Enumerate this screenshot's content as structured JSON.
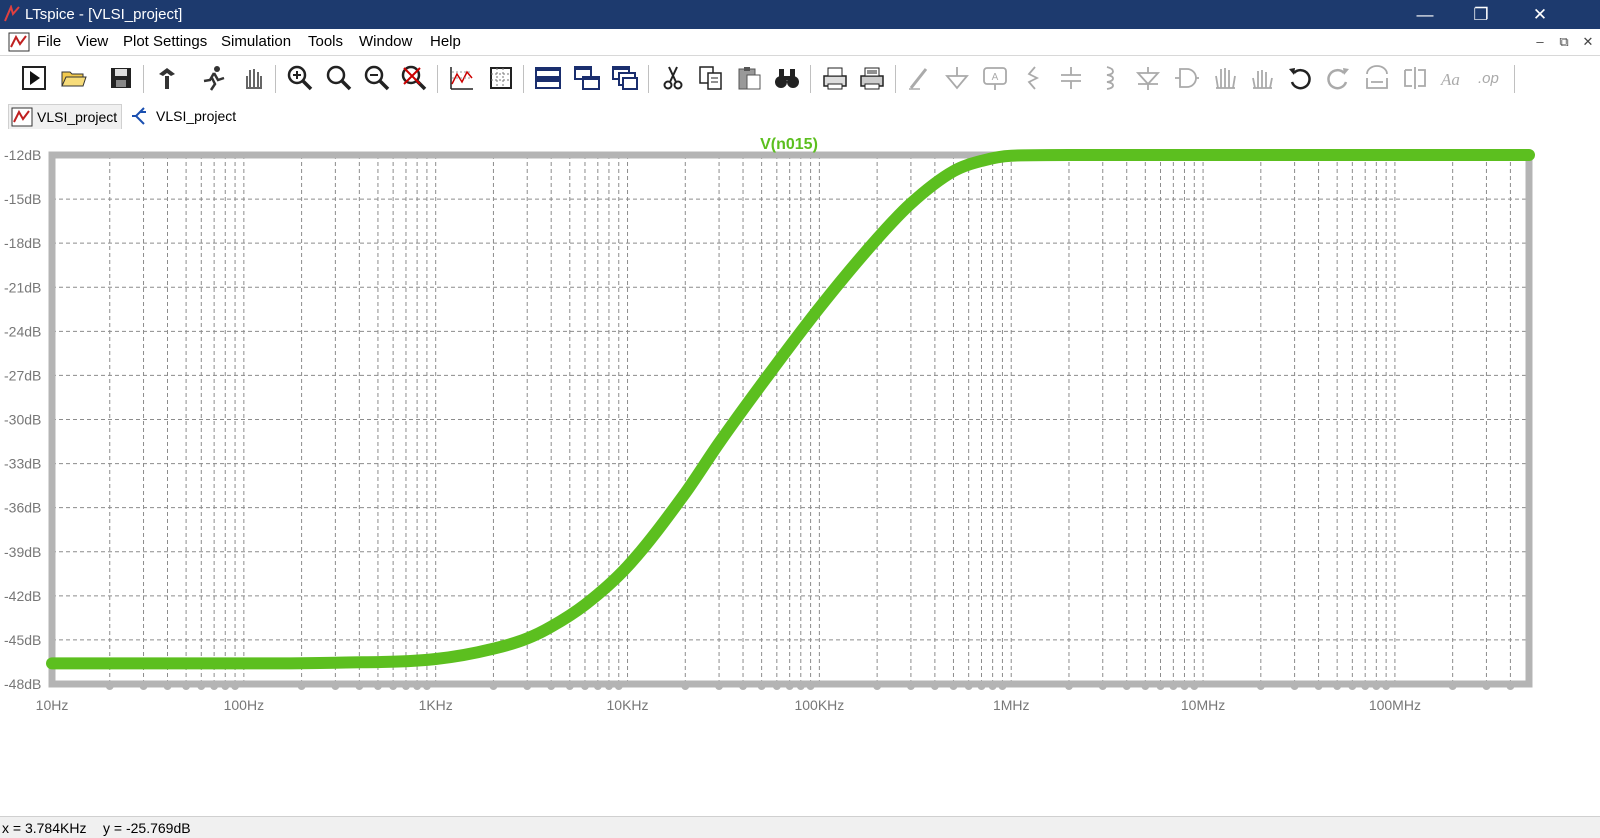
{
  "window": {
    "title": "LTspice - [VLSI_project]",
    "controls": {
      "minimize": "—",
      "restore": "❐",
      "close": "✕"
    }
  },
  "menu": {
    "items": [
      "File",
      "View",
      "Plot Settings",
      "Simulation",
      "Tools",
      "Window",
      "Help"
    ],
    "mdi_controls": {
      "minimize": "–",
      "restore": "⧉",
      "close": "✕"
    }
  },
  "toolbar": {
    "icons": [
      "run-icon",
      "open-icon",
      "save-icon",
      "control-panel-icon",
      "run-sim-icon",
      "pan-icon",
      "zoom-in-icon",
      "zoom-area-icon",
      "zoom-out-icon",
      "zoom-fit-icon",
      "autorange-icon",
      "grid-icon",
      "tile-horizontal-icon",
      "cascade-icon",
      "tile-vertical-icon",
      "cut-icon",
      "copy-icon",
      "paste-icon",
      "find-icon",
      "print-preview-icon",
      "print-icon",
      "draw-wire-icon",
      "ground-icon",
      "label-net-icon",
      "resistor-icon",
      "capacitor-icon",
      "inductor-icon",
      "diode-icon",
      "component-icon",
      "move-icon",
      "drag-icon",
      "undo-icon",
      "redo-icon",
      "rotate-icon",
      "mirror-icon",
      "text-icon",
      "spice-directive-icon"
    ]
  },
  "tabs": [
    {
      "label": "VLSI_project",
      "icon": "waveform-icon",
      "active": true
    },
    {
      "label": "VLSI_project",
      "icon": "schematic-icon",
      "active": false
    }
  ],
  "chart_data": {
    "type": "line",
    "title": "V(n015)",
    "xscale": "log",
    "xlim": [
      10,
      500000000
    ],
    "ylim": [
      -48,
      -12
    ],
    "xticks": [
      10,
      100,
      1000,
      10000,
      100000,
      1000000,
      10000000,
      100000000
    ],
    "xtick_labels": [
      "10Hz",
      "100Hz",
      "1KHz",
      "10KHz",
      "100KHz",
      "1MHz",
      "10MHz",
      "100MHz"
    ],
    "yticks": [
      -12,
      -15,
      -18,
      -21,
      -24,
      -27,
      -30,
      -33,
      -36,
      -39,
      -42,
      -45,
      -48
    ],
    "ytick_labels": [
      "-12dB",
      "-15dB",
      "-18dB",
      "-21dB",
      "-24dB",
      "-27dB",
      "-30dB",
      "-33dB",
      "-36dB",
      "-39dB",
      "-42dB",
      "-45dB",
      "-48dB"
    ],
    "grid": true,
    "series": [
      {
        "name": "V(n015)",
        "color": "#5cbf1f",
        "x": [
          10,
          100,
          300,
          1000,
          2000,
          3000,
          4000,
          6000,
          10000,
          20000,
          30000,
          50000,
          100000,
          200000,
          300000,
          500000,
          700000,
          1000000,
          2000000,
          10000000,
          100000000,
          500000000
        ],
        "y": [
          -46.6,
          -46.6,
          -46.55,
          -46.3,
          -45.6,
          -44.9,
          -44.1,
          -42.6,
          -40.0,
          -35.0,
          -31.6,
          -27.6,
          -22.4,
          -17.7,
          -15.3,
          -13.1,
          -12.4,
          -12.05,
          -12.0,
          -12.0,
          -12.0,
          -12.0
        ]
      }
    ]
  },
  "status": {
    "cursor_x": "x = 3.784KHz",
    "cursor_y": "y = -25.769dB"
  }
}
